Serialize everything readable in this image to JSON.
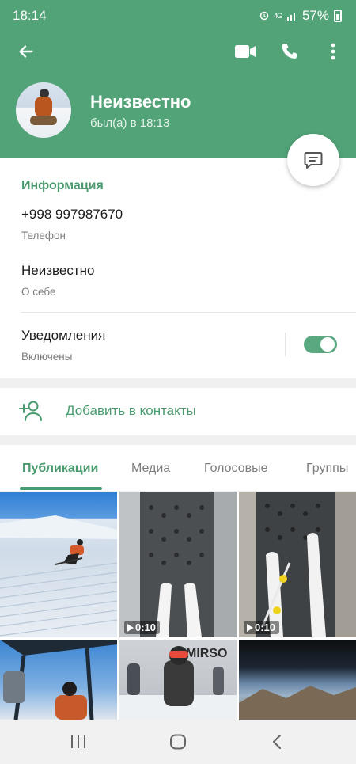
{
  "status": {
    "time": "18:14",
    "network": "4G",
    "battery": "57%"
  },
  "header": {
    "name": "Неизвестно",
    "last_seen": "был(а) в 18:13",
    "icons": [
      "back-arrow-icon",
      "video-call-icon",
      "phone-icon",
      "more-vert-icon",
      "message-icon"
    ]
  },
  "info": {
    "title": "Информация",
    "phone_value": "+998 997987670",
    "phone_label": "Телефон",
    "bio_value": "Неизвестно",
    "bio_label": "О себе",
    "notif_value": "Уведомления",
    "notif_label": "Включены",
    "notifications_on": true
  },
  "add_contact": {
    "label": "Добавить в контакты"
  },
  "tabs": [
    {
      "label": "Публикации",
      "active": true
    },
    {
      "label": "Медиа",
      "active": false
    },
    {
      "label": "Голосовые",
      "active": false
    },
    {
      "label": "Группы",
      "active": false
    }
  ],
  "media": [
    {
      "type": "photo"
    },
    {
      "type": "video",
      "duration": "0:10"
    },
    {
      "type": "video",
      "duration": "0:10"
    },
    {
      "type": "photo"
    },
    {
      "type": "photo",
      "text": "MIRSO"
    },
    {
      "type": "photo"
    }
  ],
  "colors": {
    "accent": "#52a378",
    "accent_text": "#4a9a6f"
  }
}
